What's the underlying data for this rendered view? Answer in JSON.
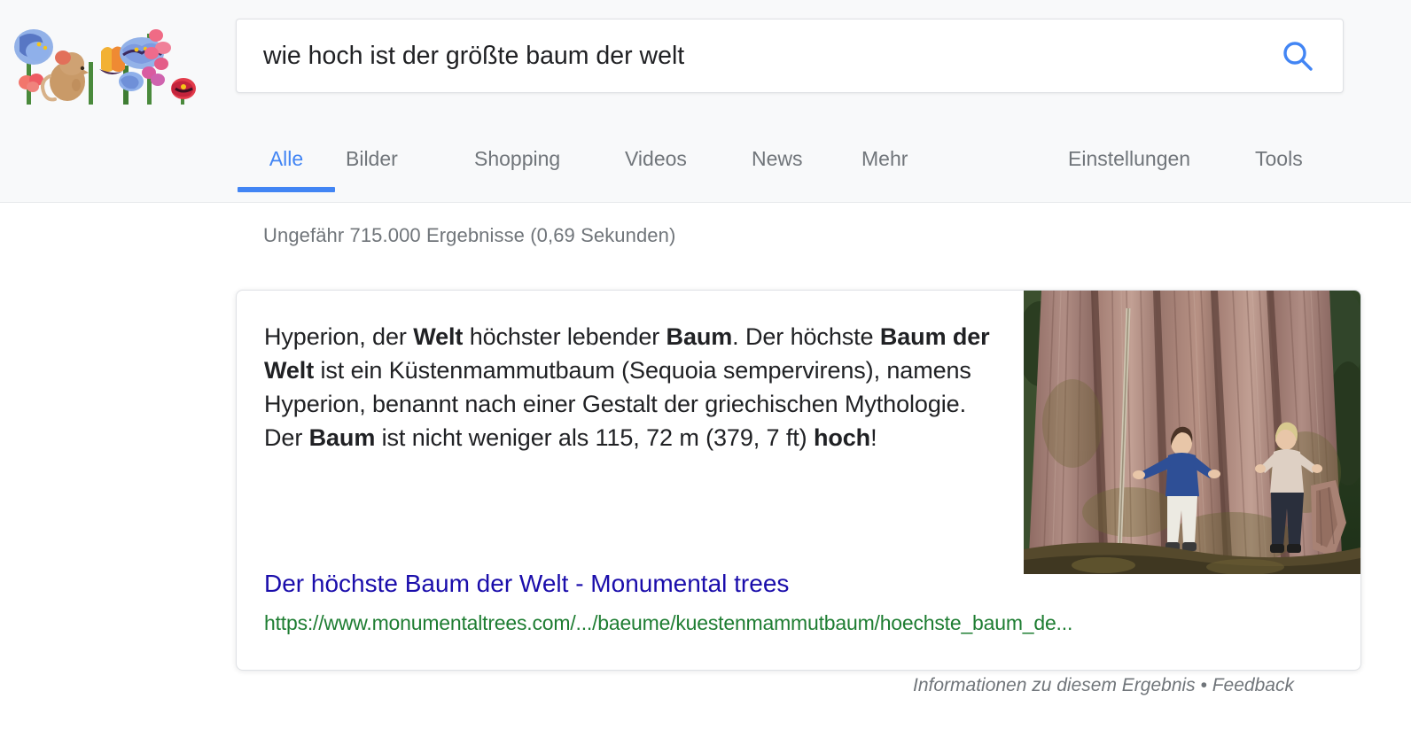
{
  "logo": {
    "name": "google-doodle-flowers-mouse",
    "alt": "Google Doodle: flowers and a mouse"
  },
  "search": {
    "value": "wie hoch ist der größte baum der welt",
    "placeholder": "Im Web suchen",
    "icon": "search-icon",
    "icon_color": "#4285f4"
  },
  "nav": {
    "tabs": [
      {
        "label": "Alle",
        "active": true
      },
      {
        "label": "Bilder",
        "active": false
      },
      {
        "label": "Shopping",
        "active": false
      },
      {
        "label": "Videos",
        "active": false
      },
      {
        "label": "News",
        "active": false
      },
      {
        "label": "Mehr",
        "active": false
      }
    ],
    "right_items": [
      {
        "label": "Einstellungen"
      },
      {
        "label": "Tools"
      }
    ],
    "active_color": "#4285f4"
  },
  "results": {
    "count_text": "Ungefähr 715.000 Ergebnisse (0,69 Sekunden)",
    "featured": {
      "answer_parts": [
        {
          "text": "Hyperion, der ",
          "bold": false
        },
        {
          "text": "Welt",
          "bold": true
        },
        {
          "text": " höchster lebender ",
          "bold": false
        },
        {
          "text": "Baum",
          "bold": true
        },
        {
          "text": ". Der höchste ",
          "bold": false
        },
        {
          "text": "Baum der Welt",
          "bold": true
        },
        {
          "text": " ist ein Küstenmammutbaum (Sequoia sempervirens), namens Hyperion, benannt nach einer Gestalt der griechischen Mythologie. Der ",
          "bold": false
        },
        {
          "text": "Baum",
          "bold": true
        },
        {
          "text": " ist nicht weniger als 115, 72 m (379, 7 ft) ",
          "bold": false
        },
        {
          "text": "hoch",
          "bold": true
        },
        {
          "text": "!",
          "bold": false
        }
      ],
      "link_title": "Der höchste Baum der Welt - Monumental trees",
      "link_color": "#1a0dab",
      "url": "https://www.monumentaltrees.com/.../baeume/kuestenmammutbaum/hoechste_baum_de...",
      "url_color": "#1e7d32",
      "thumbnail_alt": "Zwei Personen stehen am Fuß eines riesigen Küstenmammutbaums"
    }
  },
  "footer": {
    "info_label": "Informationen zu diesem Ergebnis",
    "separator": "•",
    "feedback_label": "Feedback"
  }
}
